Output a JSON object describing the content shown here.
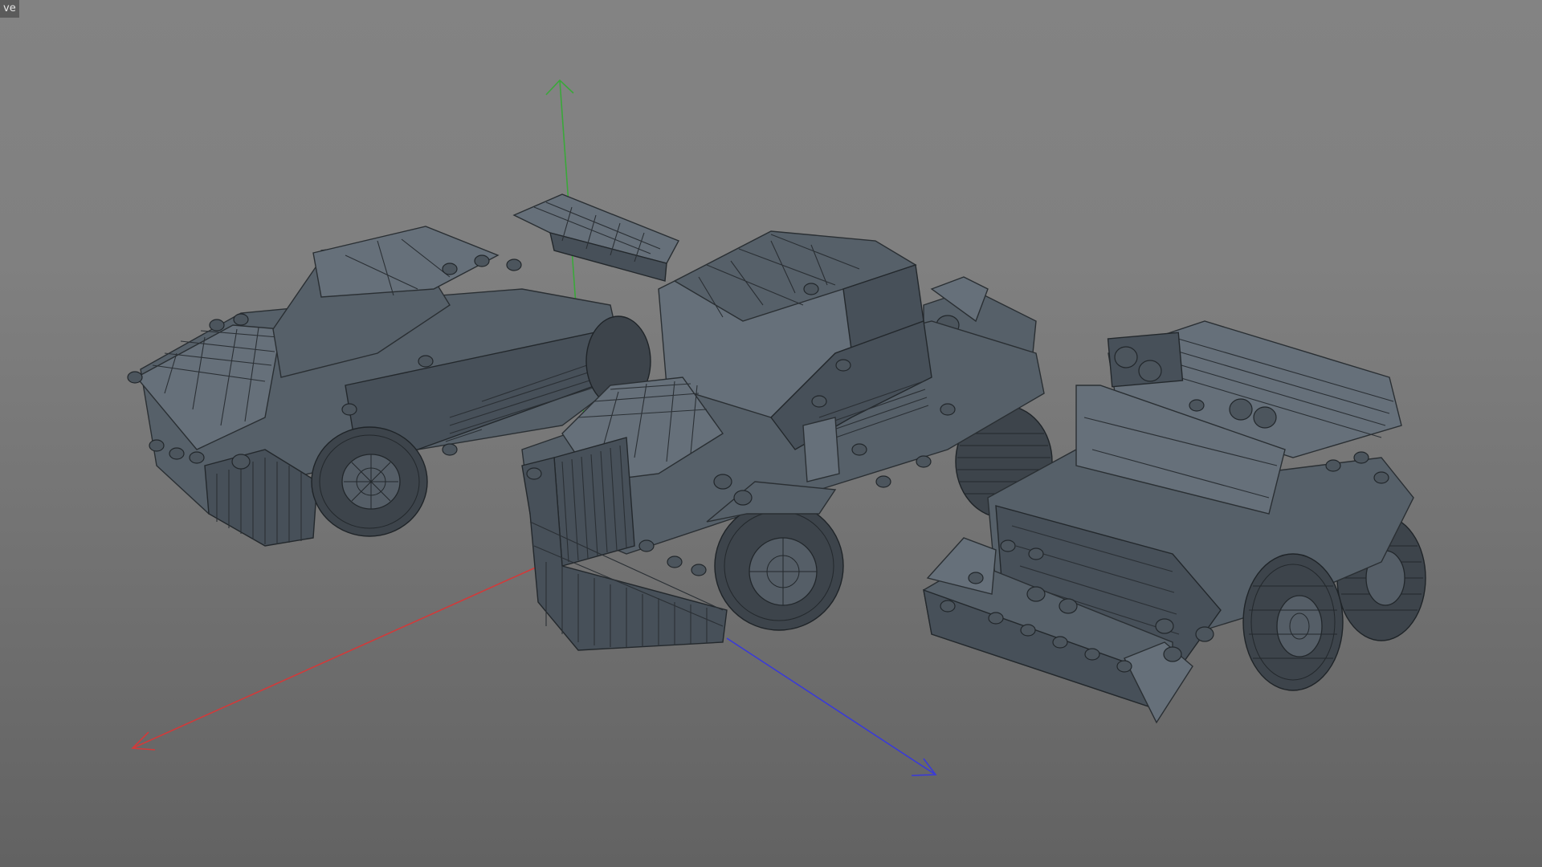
{
  "viewport": {
    "label": "ve",
    "background": "#808080"
  },
  "axes": {
    "x_color": "#d23a3a",
    "y_color": "#3aa83a",
    "z_color": "#3a3ad8"
  },
  "scene": {
    "objects": [
      "sports-car-model",
      "truck-cab-model",
      "offroad-vehicle-model"
    ],
    "display_mode": "shaded-wireframe"
  }
}
